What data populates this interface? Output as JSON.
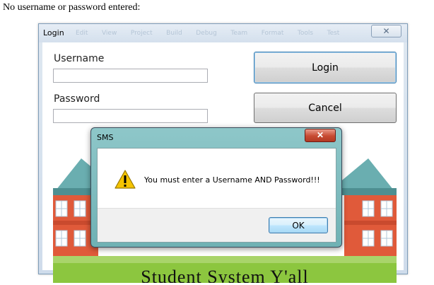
{
  "caption": "No username or password entered:",
  "login_window": {
    "title": "Login",
    "ghost_menu": [
      "Edit",
      "View",
      "Project",
      "Build",
      "Debug",
      "Team",
      "Format",
      "Tools",
      "Test"
    ],
    "close_glyph": "✕",
    "username_label": "Username",
    "username_value": "",
    "password_label": "Password",
    "password_value": "",
    "login_button": "Login",
    "cancel_button": "Cancel",
    "banner_text": "Student System Y'all"
  },
  "dialog": {
    "title": "SMS",
    "close_glyph": "✕",
    "icon": "warning-icon",
    "message": "You must enter a Username AND Password!!!",
    "ok_button": "OK"
  },
  "colors": {
    "building_brick": "#e05a3a",
    "roof": "#5fa6a6",
    "grass": "#8cc63f",
    "dialog_frame": "#7fbec1",
    "close_red": "#c74a32",
    "warning_yellow": "#f5c400"
  }
}
